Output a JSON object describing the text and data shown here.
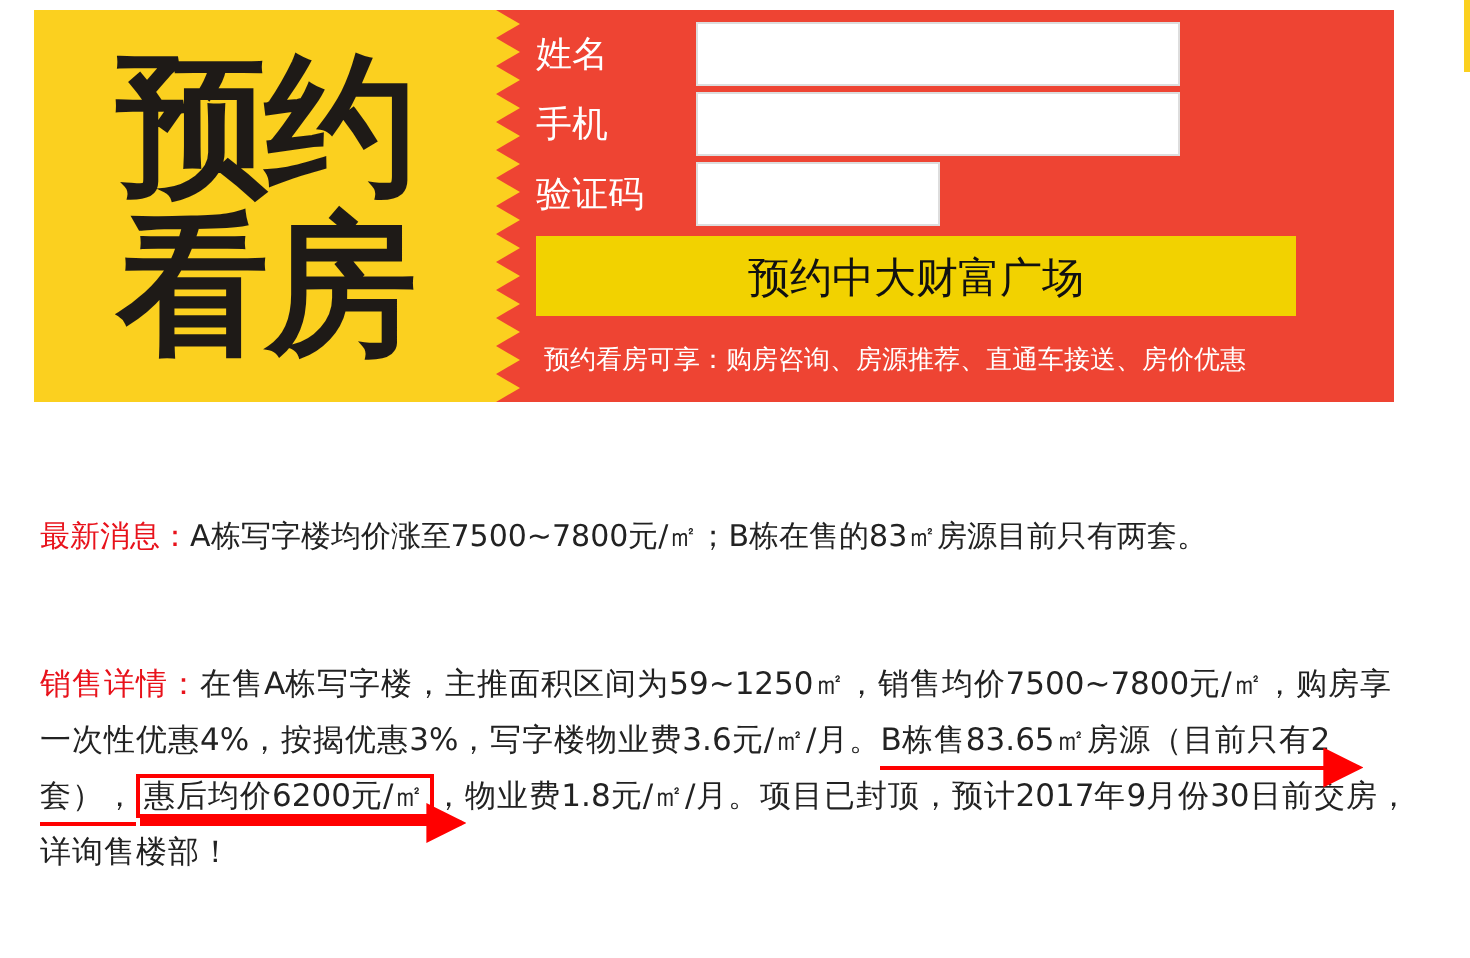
{
  "banner": {
    "title_lines": [
      "预约",
      "看房"
    ],
    "fields": [
      {
        "label": "姓名",
        "kind": "wide"
      },
      {
        "label": "手机",
        "kind": "wide"
      },
      {
        "label": "验证码",
        "kind": "short"
      }
    ],
    "button": "预约中大财富广场",
    "benefits": "预约看房可享：购房咨询、房源推荐、直通车接送、房价优惠"
  },
  "news": {
    "label": "最新消息：",
    "text": "A栋写字楼均价涨至7500~7800元/㎡；B栋在售的83㎡房源目前只有两套。"
  },
  "sales": {
    "label": "销售详情：",
    "lines": [
      [
        {
          "text": "在售A栋写字楼，主推面积区间为59~1250㎡，销售均价7500~7800元/㎡，购房享",
          "underline": false,
          "boxed": false
        }
      ],
      [
        {
          "text": "一次性优惠4%，按揭优惠3%，写字楼物业费3.6元/㎡/月。",
          "underline": false,
          "boxed": false
        },
        {
          "text": "B栋售83.65㎡房源（目前只有2",
          "underline": true,
          "boxed": false
        }
      ],
      [
        {
          "text": "套），",
          "underline": true,
          "boxed": false
        },
        {
          "text": "惠后均价6200元/㎡",
          "underline": true,
          "boxed": true
        },
        {
          "text": "，物业费1.8元/㎡/月。项目已封顶，预计2017年9月份30日前交房，",
          "underline": false,
          "boxed": false
        }
      ],
      [
        {
          "text": "详询售楼部！",
          "underline": false,
          "boxed": false
        }
      ]
    ]
  }
}
